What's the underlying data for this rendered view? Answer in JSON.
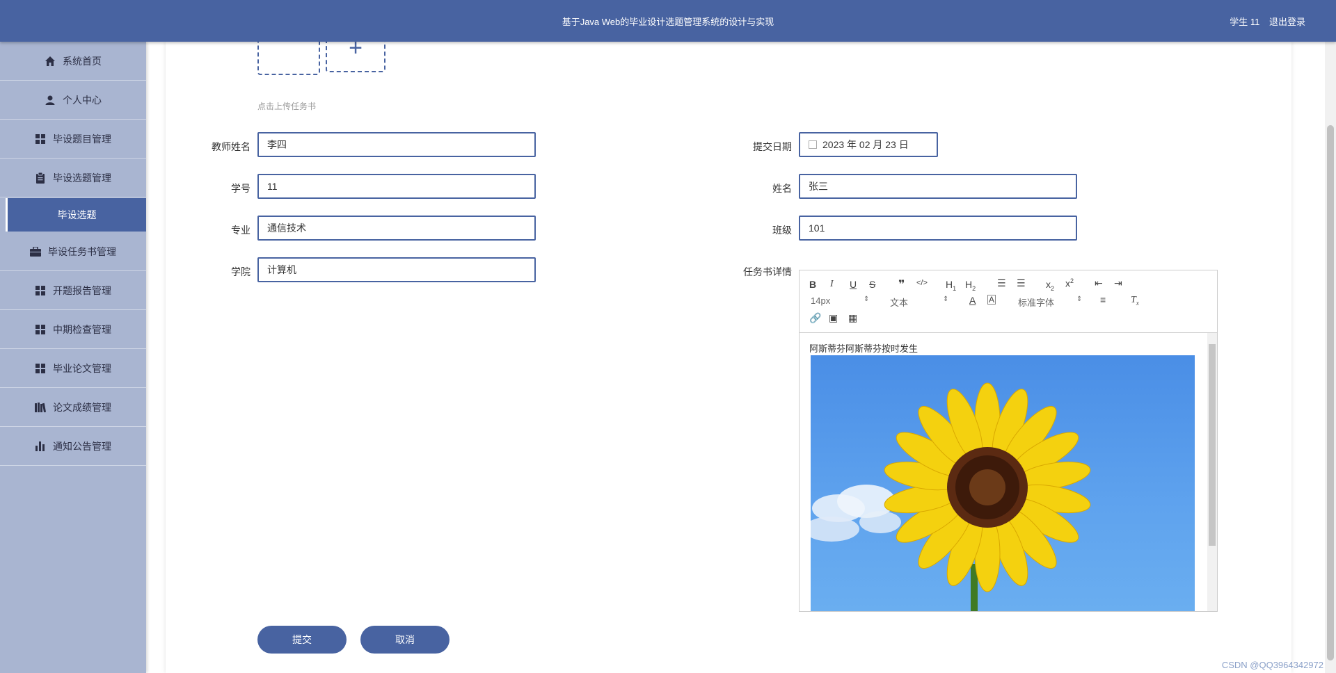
{
  "header": {
    "title": "基于Java Web的毕业设计选题管理系统的设计与实现",
    "user_label": "学生 11",
    "logout_label": "退出登录"
  },
  "sidebar": {
    "items": [
      {
        "label": "系统首页",
        "icon": "home-icon"
      },
      {
        "label": "个人中心",
        "icon": "user-icon"
      },
      {
        "label": "毕设题目管理",
        "icon": "grid-icon"
      },
      {
        "label": "毕设选题管理",
        "icon": "clipboard-icon"
      },
      {
        "label": "毕设任务书管理",
        "icon": "briefcase-icon"
      },
      {
        "label": "开题报告管理",
        "icon": "grid-icon"
      },
      {
        "label": "中期检查管理",
        "icon": "grid-icon"
      },
      {
        "label": "毕业论文管理",
        "icon": "grid-icon"
      },
      {
        "label": "论文成绩管理",
        "icon": "books-icon"
      },
      {
        "label": "通知公告管理",
        "icon": "bar-chart-icon"
      }
    ],
    "active_submenu": "毕设选题"
  },
  "form": {
    "upload_hint": "点击上传任务书",
    "teacher_label": "教师姓名",
    "teacher_value": "李四",
    "date_label": "提交日期",
    "date_value": "2023 年 02 月 23 日",
    "student_no_label": "学号",
    "student_no_value": "11",
    "name_label": "姓名",
    "name_value": "张三",
    "major_label": "专业",
    "major_value": "通信技术",
    "class_label": "班级",
    "class_value": "101",
    "college_label": "学院",
    "college_value": "计算机",
    "detail_label": "任务书详情"
  },
  "editor": {
    "font_size": "14px",
    "paragraph": "文本",
    "font_family": "标准字体",
    "content_text": "阿斯蒂芬阿斯蒂芬按时发生",
    "image_desc": "sunflower"
  },
  "buttons": {
    "submit": "提交",
    "cancel": "取消"
  },
  "watermark": "CSDN @QQ3964342972",
  "colors": {
    "primary": "#4863a1",
    "sidebar_bg": "#a9b5d1"
  }
}
